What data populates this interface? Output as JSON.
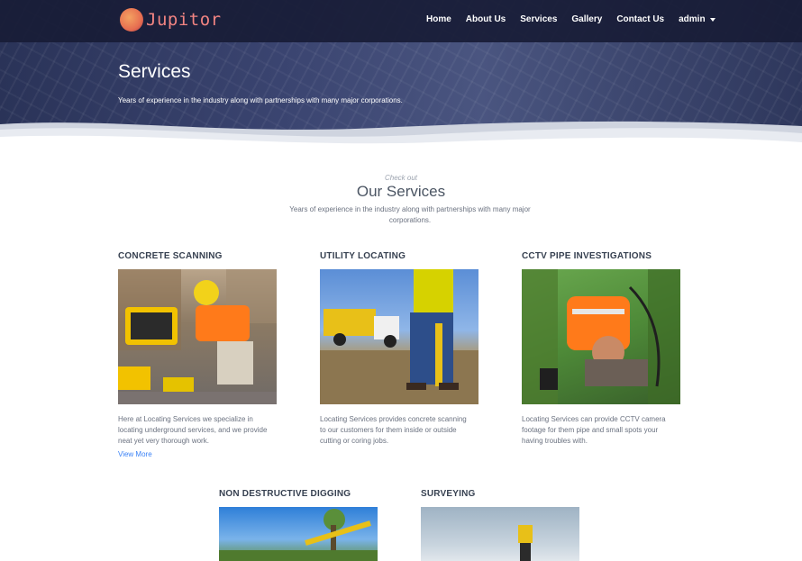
{
  "brand": {
    "name": "Jupitor"
  },
  "nav": {
    "items": [
      {
        "label": "Home"
      },
      {
        "label": "About Us"
      },
      {
        "label": "Services"
      },
      {
        "label": "Gallery"
      },
      {
        "label": "Contact Us"
      },
      {
        "label": "admin"
      }
    ]
  },
  "hero": {
    "title": "Services",
    "subtitle": "Years of experience in the industry along with partnerships with many major corporations."
  },
  "section": {
    "kicker": "Check out",
    "title": "Our Services",
    "description": "Years of experience in the industry along with partnerships with many major corporations."
  },
  "services": [
    {
      "title": "Concrete Scanning",
      "text": "Here at Locating Services we specialize in locating underground services, and we provide neat yet very thorough work.",
      "link": "View More"
    },
    {
      "title": "Utility Locating",
      "text": "Locating Services provides concrete scanning to our customers for them inside or outside cutting or coring jobs."
    },
    {
      "title": "CCTV Pipe Investigations",
      "text": "Locating Services can provide CCTV camera footage for them pipe and small spots your having troubles with."
    },
    {
      "title": "Non Destructive Digging"
    },
    {
      "title": "Surveying"
    }
  ],
  "colors": {
    "navbar": "#181c36",
    "brand_text": "#f28482",
    "link": "#3b82f6"
  }
}
